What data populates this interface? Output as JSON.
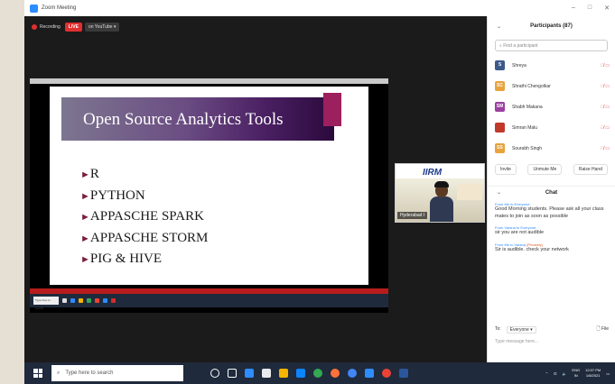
{
  "window": {
    "title": "Zoom Meeting"
  },
  "recording": {
    "label": "Recording",
    "live": "LIVE",
    "stream": "on YouTube ▾"
  },
  "slide": {
    "title": "Open Source Analytics Tools",
    "bullets": [
      "R",
      "PYTHON",
      "APPASCHE SPARK",
      "APPASCHE STORM",
      "PIG & HIVE"
    ]
  },
  "inner_search": "Type here to search",
  "video": {
    "org": "IIRM",
    "name": "Hyderabad I"
  },
  "participants": {
    "header": "Participants (87)",
    "search_placeholder": "Find a participant",
    "list": [
      {
        "initials": "S",
        "name": "Shreya",
        "color": "#3c5a8a"
      },
      {
        "initials": "SC",
        "name": "Shrathi Chengolkar",
        "color": "#e8a33d"
      },
      {
        "initials": "SM",
        "name": "Shabh Makana",
        "color": "#9b3fa0"
      },
      {
        "initials": "",
        "name": "Simran Malu",
        "color": "#c0392b"
      },
      {
        "initials": "SS",
        "name": "Sourabh Singh",
        "color": "#e8a33d"
      }
    ],
    "buttons": [
      "Invite",
      "Unmute Me",
      "Raise Hand"
    ]
  },
  "chat": {
    "header": "Chat",
    "messages": [
      {
        "from": "From Me to Everyone:",
        "private": "",
        "text": "Good Morning students. Please ask all your class mates to join as soon as possible"
      },
      {
        "from": "From Varsha to Everyone:",
        "private": "",
        "text": "sir you are not audible"
      },
      {
        "from": "From Me to Varsha",
        "private": "(Privately)",
        "text": "Sir is audible. check your network"
      }
    ],
    "to_label": "To:",
    "to_value": "Everyone ▾",
    "file_label": "File",
    "input_placeholder": "Type message here..."
  },
  "taskbar": {
    "search": "Type here to search",
    "lang": "ENG",
    "region": "IN",
    "time": "12:07 PM",
    "date": "1/8/2021"
  },
  "colors": {
    "accent": "#2d8cff",
    "live": "#e02f2f",
    "banner": "#4a1f62"
  }
}
